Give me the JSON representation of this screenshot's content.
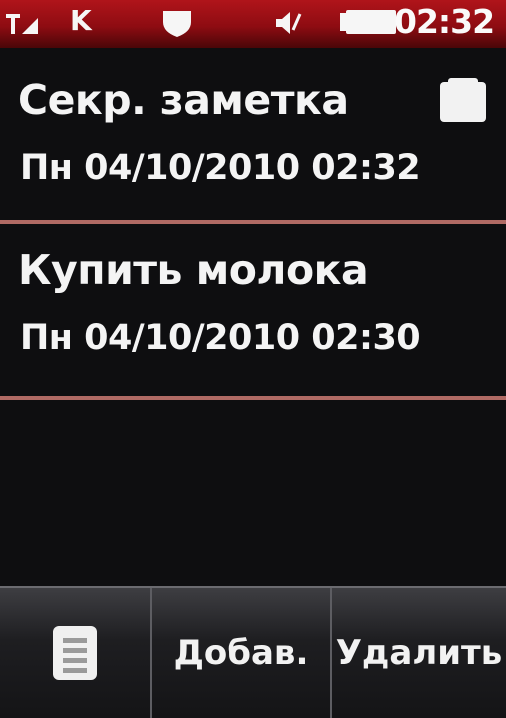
{
  "status_bar": {
    "signal_icon": "signal-icon",
    "k_indicator": "K",
    "shield_icon": "shield-icon",
    "speaker_icon": "speaker-icon",
    "battery_icon": "battery-icon",
    "time": "02:32"
  },
  "notes": [
    {
      "title": "Секр. заметка",
      "date": "Пн 04/10/2010 02:32",
      "icon": "lock-icon"
    },
    {
      "title": "Купить молока",
      "date": "Пн 04/10/2010 02:30"
    }
  ],
  "softkeys": {
    "menu_icon": "menu-icon",
    "add_label": "Добав.",
    "delete_label": "Удалить"
  },
  "colors": {
    "status_bar": "#a0121a",
    "divider": "#b06a64",
    "background": "#0e0e10"
  }
}
